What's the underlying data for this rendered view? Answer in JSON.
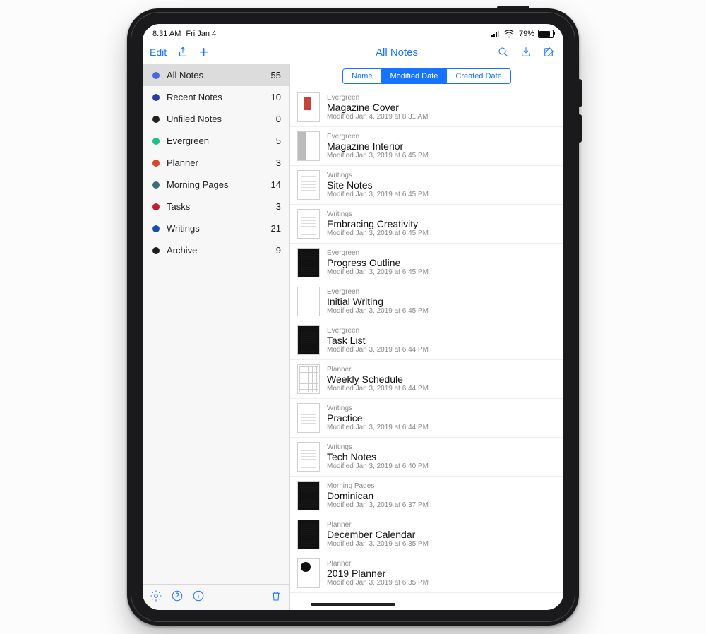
{
  "status": {
    "time": "8:31 AM",
    "date": "Fri Jan 4",
    "battery_pct": "79%"
  },
  "toolbar": {
    "edit_label": "Edit",
    "title": "All Notes"
  },
  "segments": {
    "name": "Name",
    "modified": "Modified Date",
    "created": "Created Date",
    "active": "modified"
  },
  "sidebar": {
    "items": [
      {
        "label": "All Notes",
        "count": "55",
        "color": "#4a68d8",
        "selected": true
      },
      {
        "label": "Recent Notes",
        "count": "10",
        "color": "#2a3d9e",
        "selected": false
      },
      {
        "label": "Unfiled Notes",
        "count": "0",
        "color": "#222222",
        "selected": false
      },
      {
        "label": "Evergreen",
        "count": "5",
        "color": "#1ebf8a",
        "selected": false
      },
      {
        "label": "Planner",
        "count": "3",
        "color": "#d8472b",
        "selected": false
      },
      {
        "label": "Morning Pages",
        "count": "14",
        "color": "#3a6e7a",
        "selected": false
      },
      {
        "label": "Tasks",
        "count": "3",
        "color": "#c21f2e",
        "selected": false
      },
      {
        "label": "Writings",
        "count": "21",
        "color": "#1b4fa6",
        "selected": false
      },
      {
        "label": "Archive",
        "count": "9",
        "color": "#1e1e1e",
        "selected": false
      }
    ]
  },
  "notes": [
    {
      "category": "Evergreen",
      "title": "Magazine Cover",
      "modified": "Modified Jan 4, 2019 at 8:31 AM",
      "thumb": "blob"
    },
    {
      "category": "Evergreen",
      "title": "Magazine Interior",
      "modified": "Modified Jan 3, 2019 at 6:45 PM",
      "thumb": "split"
    },
    {
      "category": "Writings",
      "title": "Site Notes",
      "modified": "Modified Jan 3, 2019 at 6:45 PM",
      "thumb": "lines"
    },
    {
      "category": "Writings",
      "title": "Embracing Creativity",
      "modified": "Modified Jan 3, 2019 at 6:45 PM",
      "thumb": "lines"
    },
    {
      "category": "Evergreen",
      "title": "Progress Outline",
      "modified": "Modified Jan 3, 2019 at 6:45 PM",
      "thumb": "dark"
    },
    {
      "category": "Evergreen",
      "title": "Initial Writing",
      "modified": "Modified Jan 3, 2019 at 6:45 PM",
      "thumb": "plain"
    },
    {
      "category": "Evergreen",
      "title": "Task List",
      "modified": "Modified Jan 3, 2019 at 6:44 PM",
      "thumb": "dark"
    },
    {
      "category": "Planner",
      "title": "Weekly Schedule",
      "modified": "Modified Jan 3, 2019 at 6:44 PM",
      "thumb": "grid"
    },
    {
      "category": "Writings",
      "title": "Practice",
      "modified": "Modified Jan 3, 2019 at 6:44 PM",
      "thumb": "lines"
    },
    {
      "category": "Writings",
      "title": "Tech Notes",
      "modified": "Modified Jan 3, 2019 at 6:40 PM",
      "thumb": "lines"
    },
    {
      "category": "Morning Pages",
      "title": "Dominican",
      "modified": "Modified Jan 3, 2019 at 6:37 PM",
      "thumb": "dark"
    },
    {
      "category": "Planner",
      "title": "December Calendar",
      "modified": "Modified Jan 3, 2019 at 6:35 PM",
      "thumb": "dark"
    },
    {
      "category": "Planner",
      "title": "2019 Planner",
      "modified": "Modified Jan 3, 2019 at 6:35 PM",
      "thumb": "circle"
    }
  ]
}
